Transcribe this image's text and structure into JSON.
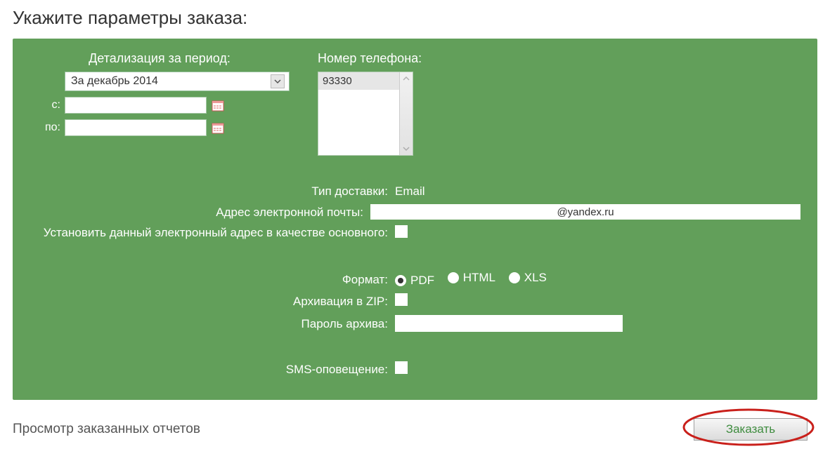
{
  "title": "Укажите параметры заказа:",
  "period": {
    "label": "Детализация за период:",
    "selected": "За декабрь 2014",
    "from_label": "с:",
    "to_label": "по:",
    "from_value": "",
    "to_value": ""
  },
  "phone": {
    "label": "Номер телефона:",
    "number": "93330"
  },
  "delivery": {
    "type_label": "Тип доставки:",
    "type_value": "Email",
    "email_label": "Адрес электронной почты:",
    "email_value": "@yandex.ru",
    "set_primary_label": "Установить данный электронный адрес в качестве основного:",
    "set_primary_checked": false
  },
  "format": {
    "label": "Формат:",
    "options": {
      "pdf": "PDF",
      "html": "HTML",
      "xls": "XLS"
    },
    "selected": "pdf",
    "zip_label": "Архивация в ZIP:",
    "zip_checked": false,
    "pwd_label": "Пароль архива:",
    "pwd_value": ""
  },
  "sms": {
    "label": "SMS-оповещение:",
    "checked": false
  },
  "footer": {
    "view_link": "Просмотр заказанных отчетов",
    "order_button": "Заказать"
  }
}
